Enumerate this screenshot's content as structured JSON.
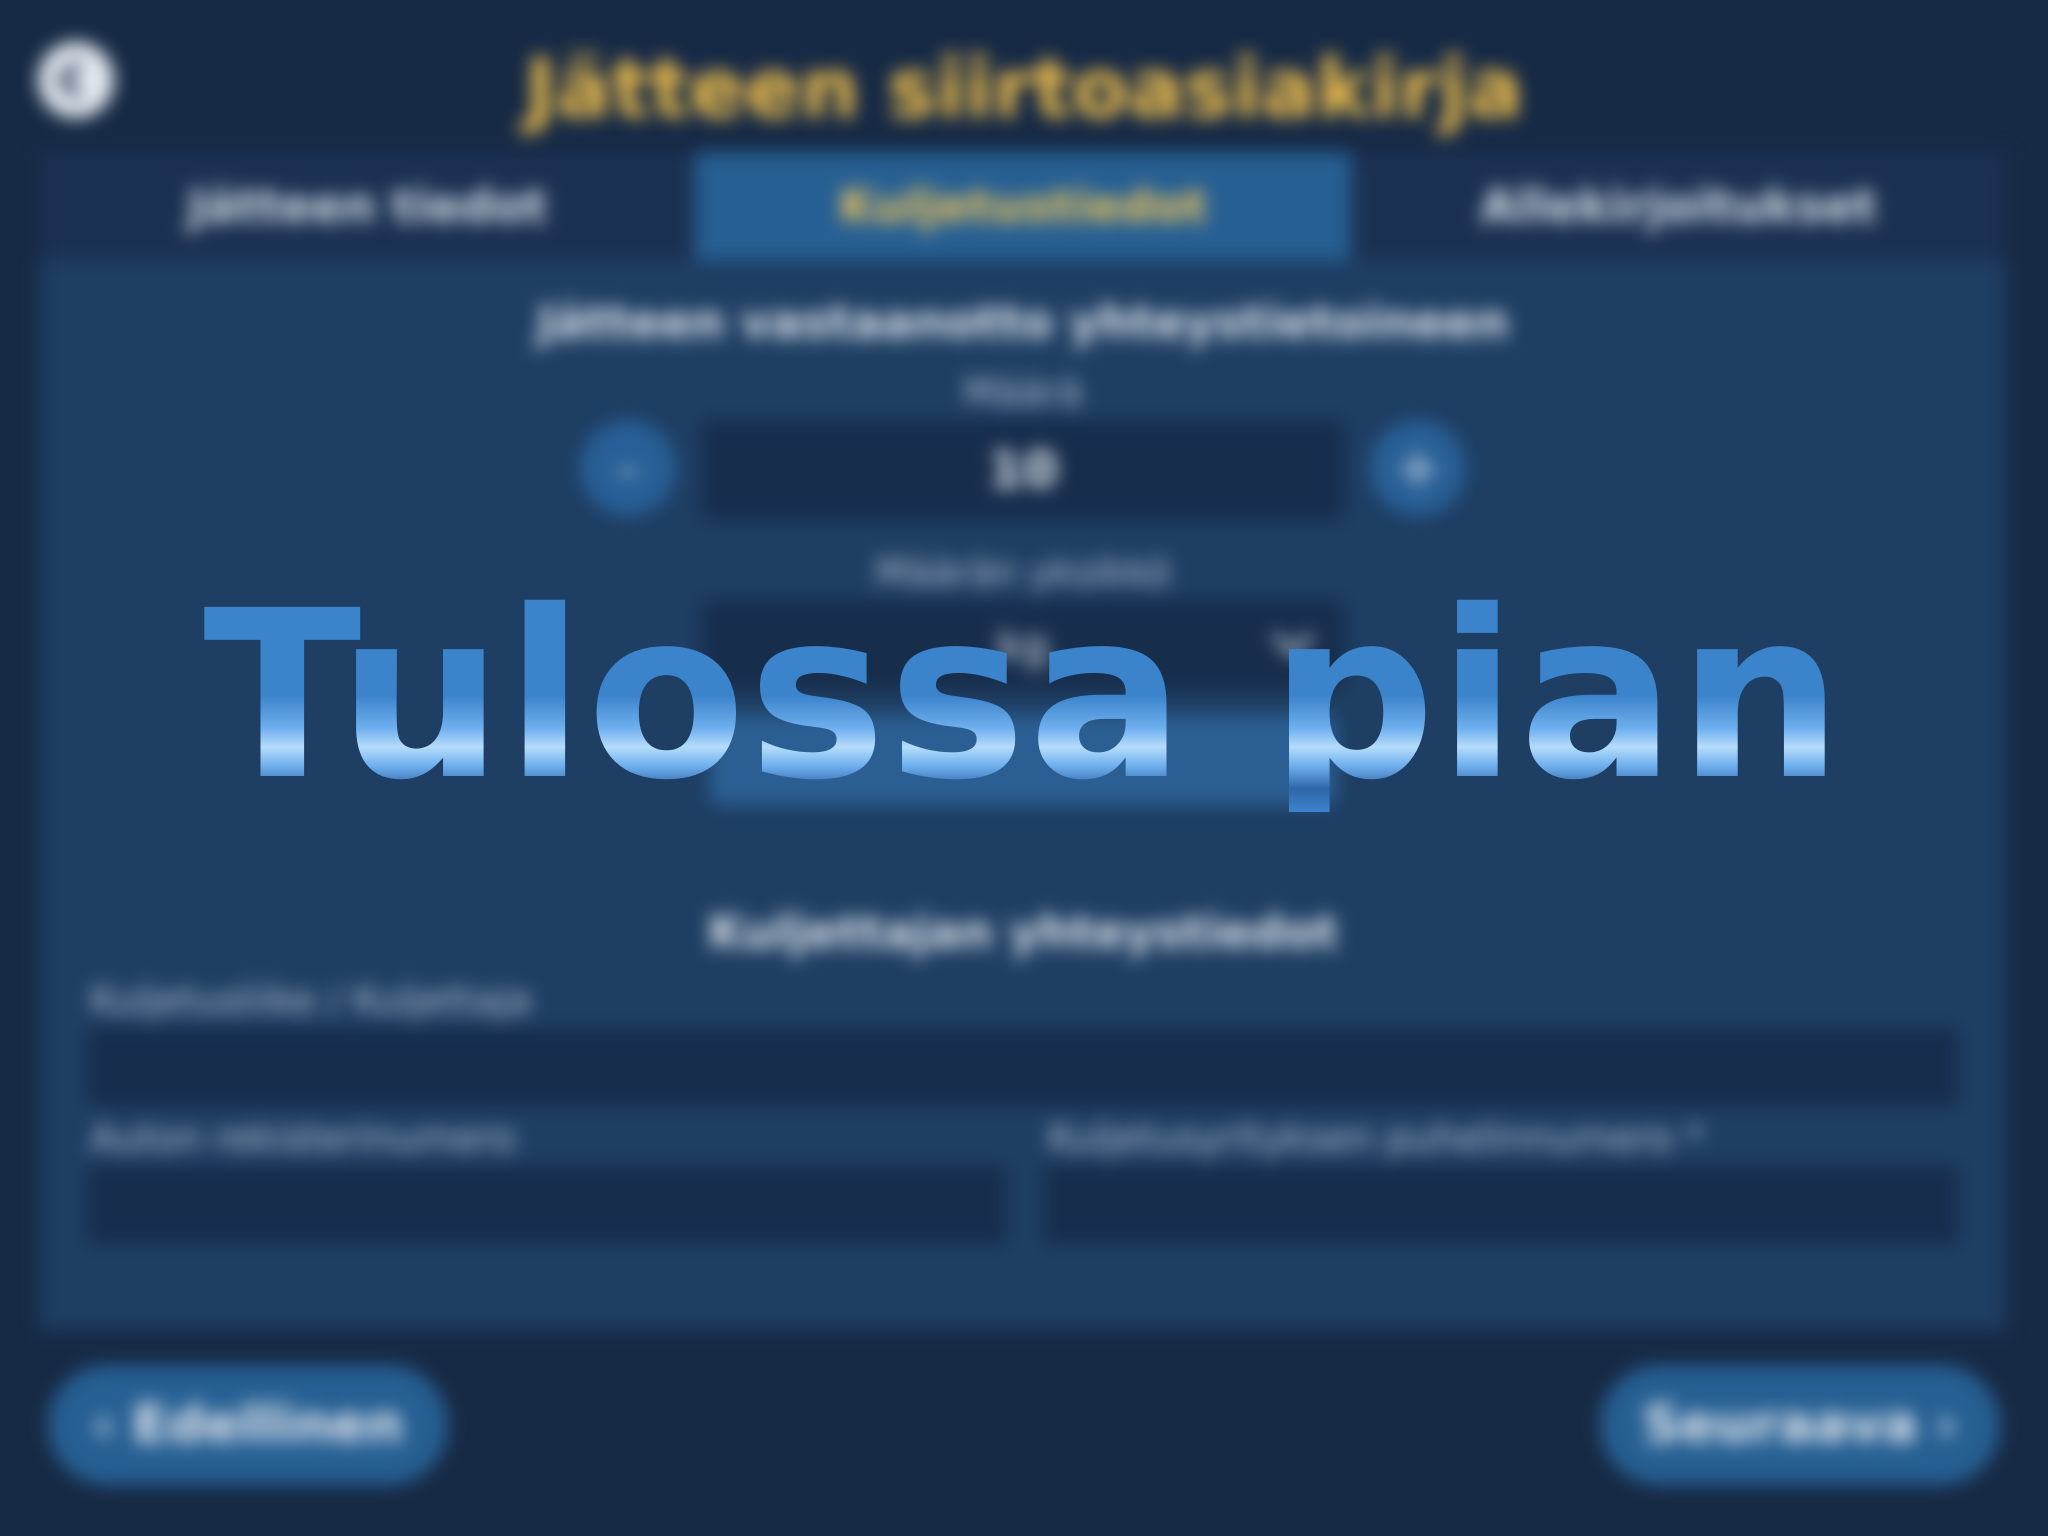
{
  "header": {
    "title": "Jätteen siirtoasiakirja"
  },
  "tabs": [
    {
      "label": "Jätteen tiedot"
    },
    {
      "label": "Kuljetustiedot"
    },
    {
      "label": "Allekirjoitukset"
    }
  ],
  "panel": {
    "section1_title": "Jätteen vastaanotto yhteystietoineen",
    "amount_label": "Määrä",
    "amount_value": "10",
    "minus_label": "-",
    "plus_label": "+",
    "unit_label": "Määrän yksikkö",
    "unit_value": "kg",
    "section2_title": "Kuljettajan yhteystiedot",
    "transporter_label": "Kuljetusliike / Kuljettaja",
    "vehicle_label": "Auton rekisterinumero",
    "phone_label": "Kuljetusyrityksen puhelinnumero *"
  },
  "nav": {
    "back_label": "‹ Edellinen",
    "next_label": "Seuraava ›"
  },
  "overlay": {
    "text": "Tulossa pian"
  }
}
